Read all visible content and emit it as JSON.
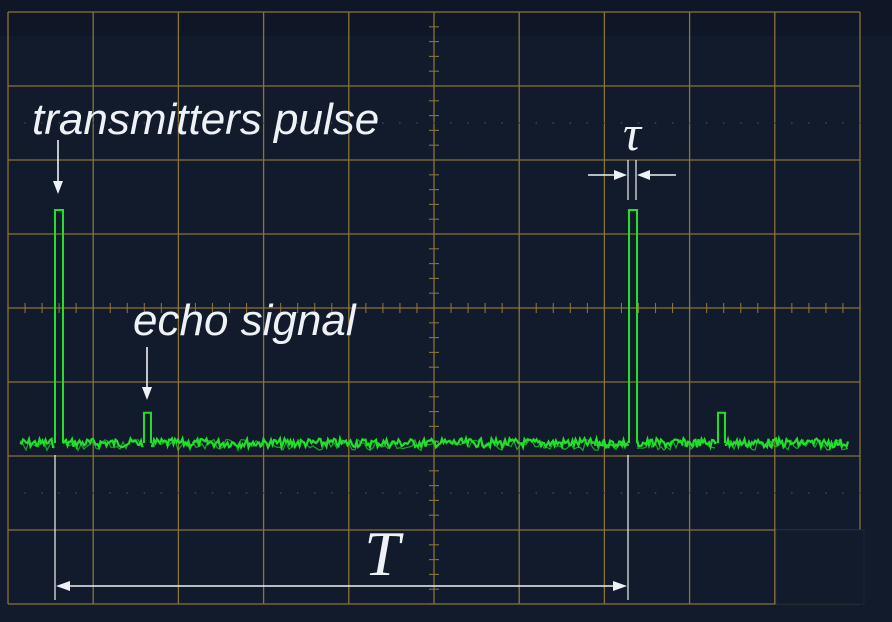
{
  "labels": {
    "transmitter": "transmitters pulse",
    "echo": "echo signal",
    "tau": "τ",
    "period": "T"
  },
  "colors": {
    "background": "#121b2b",
    "grid": "#8a7238",
    "trace": "#22e02a",
    "annotation": "#eef1f5"
  },
  "trace": {
    "pulses": [
      {
        "kind": "transmitter",
        "position": 0.0
      },
      {
        "kind": "echo",
        "position": 0.155
      },
      {
        "kind": "transmitter",
        "position": 1.0
      },
      {
        "kind": "echo",
        "position": 1.155
      }
    ],
    "pulse_level": 1.0,
    "echo_level": 0.13
  }
}
